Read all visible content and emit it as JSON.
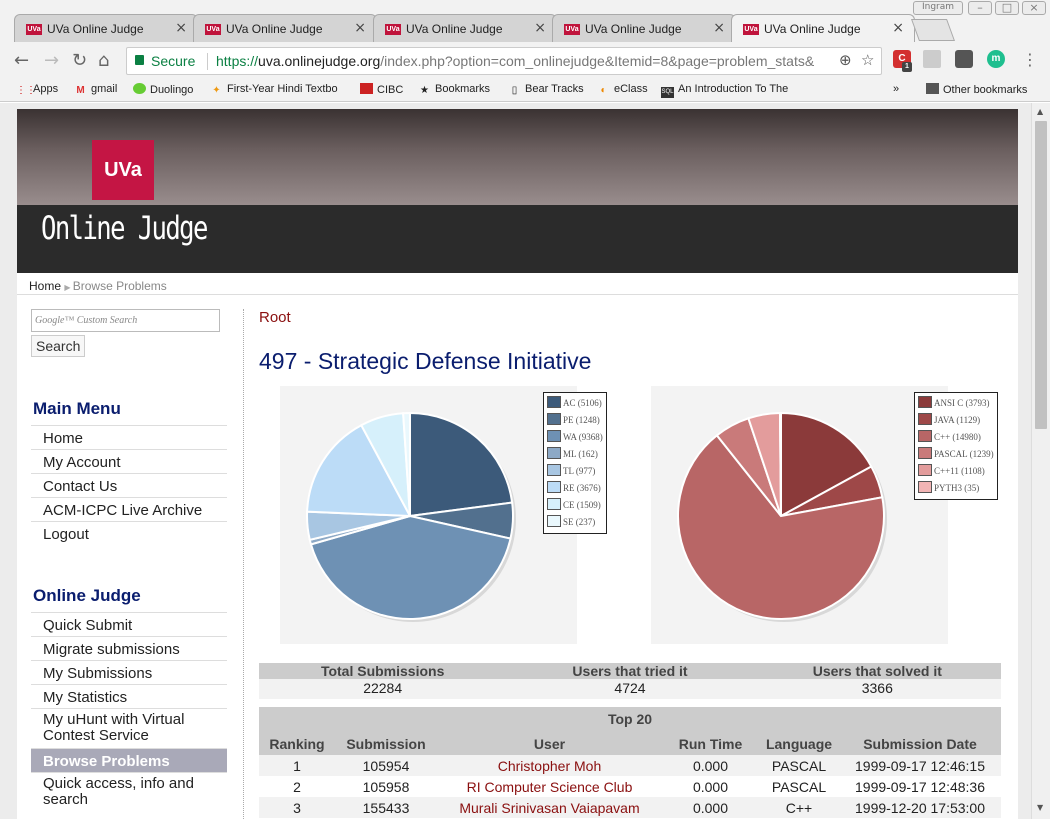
{
  "browser": {
    "tabs": [
      {
        "title": "UVa Online Judge",
        "favicon": "UVa"
      },
      {
        "title": "UVa Online Judge",
        "favicon": "UVa"
      },
      {
        "title": "UVa Online Judge",
        "favicon": "UVa"
      },
      {
        "title": "UVa Online Judge",
        "favicon": "UVa"
      },
      {
        "title": "UVa Online Judge",
        "favicon": "UVa"
      }
    ],
    "window_label": "Ingram",
    "secure_label": "Secure",
    "url_scheme": "https://",
    "url_host": "uva.onlinejudge.org",
    "url_path": "/index.php?option=com_onlinejudge&Itemid=8&page=problem_stats&",
    "extension_badge": "1",
    "profile_letter": "m",
    "bookmarks": [
      "Apps",
      "gmail",
      "Duolingo",
      "First-Year Hindi Textbo",
      "CIBC",
      "Bookmarks",
      "Bear Tracks",
      "eClass",
      "An Introduction To The"
    ],
    "bookmarks_overflow": "»",
    "other_bookmarks": "Other bookmarks"
  },
  "site": {
    "logo_text": "UVa",
    "banner_title": "Online Judge",
    "breadcrumb": {
      "home": "Home",
      "current": "Browse Problems"
    }
  },
  "search": {
    "placeholder": "Google™ Custom Search",
    "button": "Search"
  },
  "main_menu": {
    "title": "Main Menu",
    "items": [
      "Home",
      "My Account",
      "Contact Us",
      "ACM-ICPC Live Archive",
      "Logout"
    ]
  },
  "online_judge_menu": {
    "title": "Online Judge",
    "items": [
      "Quick Submit",
      "Migrate submissions",
      "My Submissions",
      "My Statistics",
      "My uHunt with Virtual Contest Service",
      "Browse Problems",
      "Quick access, info and search"
    ]
  },
  "content": {
    "root_link": "Root",
    "problem_title": "497 - Strategic Defense Initiative"
  },
  "chart_data": [
    {
      "type": "pie",
      "title": "",
      "categories": [
        "AC",
        "PE",
        "WA",
        "ML",
        "TL",
        "RE",
        "CE",
        "SE"
      ],
      "values": [
        5106,
        1248,
        9368,
        162,
        977,
        3676,
        1509,
        237
      ],
      "legend": [
        "AC (5106)",
        "PE (1248)",
        "WA (9368)",
        "ML (162)",
        "TL (977)",
        "RE (3676)",
        "CE (1509)",
        "SE (237)"
      ],
      "colors": [
        "#3c5a7a",
        "#52708e",
        "#6e91b4",
        "#8da9c6",
        "#a8c6e2",
        "#bcdcf7",
        "#d6f0fb",
        "#eaf8fd"
      ],
      "legend_position": "top-right"
    },
    {
      "type": "pie",
      "title": "",
      "categories": [
        "ANSI C",
        "JAVA",
        "C++",
        "PASCAL",
        "C++11",
        "PYTH3"
      ],
      "values": [
        3793,
        1129,
        14980,
        1239,
        1108,
        35
      ],
      "legend": [
        "ANSI C (3793)",
        "JAVA (1129)",
        "C++ (14980)",
        "PASCAL (1239)",
        "C++11 (1108)",
        "PYTH3 (35)"
      ],
      "colors": [
        "#8b3a3a",
        "#9e4848",
        "#b86666",
        "#c97a7a",
        "#e39c9c",
        "#f1b4b4"
      ],
      "legend_position": "top-right"
    }
  ],
  "stats": {
    "headers": [
      "Total Submissions",
      "Users that tried it",
      "Users that solved it"
    ],
    "values": [
      "22284",
      "4724",
      "3366"
    ]
  },
  "top20": {
    "title": "Top 20",
    "headers": [
      "Ranking",
      "Submission",
      "User",
      "Run Time",
      "Language",
      "Submission Date"
    ],
    "rows": [
      [
        "1",
        "105954",
        "Christopher Moh",
        "0.000",
        "PASCAL",
        "1999-09-17 12:46:15"
      ],
      [
        "2",
        "105958",
        "RI Computer Science Club",
        "0.000",
        "PASCAL",
        "1999-09-17 12:48:36"
      ],
      [
        "3",
        "155433",
        "Murali Srinivasan Vaiapavam",
        "0.000",
        "C++",
        "1999-12-20 17:53:00"
      ]
    ]
  }
}
